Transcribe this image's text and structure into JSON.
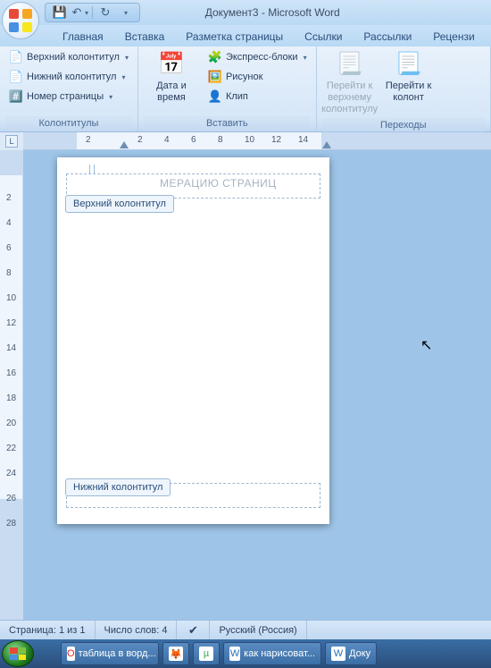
{
  "title": "Документ3 - Microsoft Word",
  "qat": {
    "save": "💾",
    "undo": "↶",
    "redo": "↻"
  },
  "tabs": [
    "Главная",
    "Вставка",
    "Разметка страницы",
    "Ссылки",
    "Рассылки",
    "Рецензи"
  ],
  "ribbon": {
    "group1": {
      "label": "Колонтитулы",
      "header": "Верхний колонтитул",
      "footer": "Нижний колонтитул",
      "page_num": "Номер страницы"
    },
    "group2": {
      "label": "Вставить",
      "datetime_big": "Дата и время",
      "qparts": "Экспресс-блоки",
      "picture": "Рисунок",
      "clip": "Клип"
    },
    "group3": {
      "label": "Переходы",
      "goto_header": "Перейти к верхнему колонтитулу",
      "goto_footer": "Перейти к колонт"
    }
  },
  "hruler_corner": "L",
  "hruler_ticks": [
    "2",
    "2",
    "4",
    "6",
    "8",
    "10",
    "12",
    "14"
  ],
  "vruler_ticks": [
    "2",
    "4",
    "6",
    "8",
    "10",
    "12",
    "14",
    "16",
    "18",
    "20",
    "22",
    "24",
    "26",
    "28"
  ],
  "page": {
    "header_tab": "Верхний колонтитул",
    "footer_tab": "Нижний колонтитул",
    "body_text": "МЕРАЦИЮ СТРАНИЦ"
  },
  "statusbar": {
    "page": "Страница: 1 из 1",
    "words": "Число слов: 4",
    "lang": "Русский (Россия)"
  },
  "taskbar": {
    "items": [
      {
        "icon": "O",
        "color": "#d22",
        "label": "таблица в ворд..."
      },
      {
        "icon": "🦊",
        "color": "#f60",
        "label": ""
      },
      {
        "icon": "µ",
        "color": "#3a5",
        "label": ""
      },
      {
        "icon": "W",
        "color": "#2a6fb5",
        "label": "как нарисоват..."
      },
      {
        "icon": "W",
        "color": "#2a6fb5",
        "label": "Доку"
      }
    ]
  }
}
